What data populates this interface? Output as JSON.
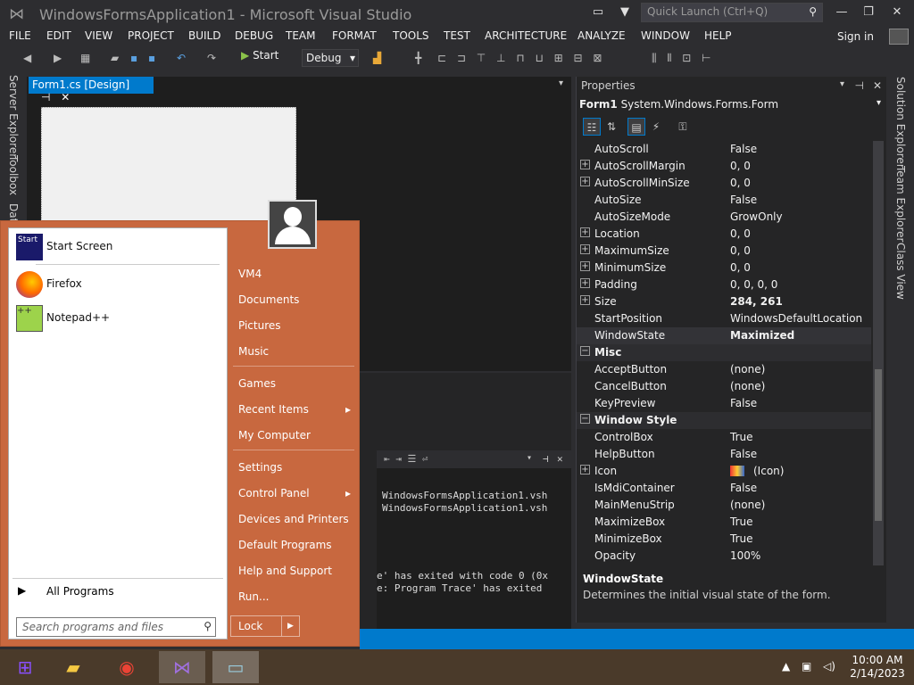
{
  "window": {
    "title": "WindowsFormsApplication1 - Microsoft Visual Studio",
    "quick_launch_placeholder": "Quick Launch (Ctrl+Q)"
  },
  "menu": [
    "FILE",
    "EDIT",
    "VIEW",
    "PROJECT",
    "BUILD",
    "DEBUG",
    "TEAM",
    "FORMAT",
    "TOOLS",
    "TEST",
    "ARCHITECTURE",
    "ANALYZE",
    "WINDOW",
    "HELP"
  ],
  "sign_in": "Sign in",
  "toolbar": {
    "start_label": "Start",
    "config": "Debug"
  },
  "doc_tab": "Form1.cs [Design]",
  "left_tabs": [
    "Server Explorer",
    "Toolbox",
    "Dat"
  ],
  "right_tabs": [
    "Solution Explorer",
    "Team Explorer",
    "Class View"
  ],
  "output": {
    "lines": [
      "WindowsFormsApplication1.vsh",
      "WindowsFormsApplication1.vsh",
      "e' has exited with code 0 (0x",
      "e: Program Trace' has exited"
    ]
  },
  "properties": {
    "header": "Properties",
    "object_name": "Form1",
    "object_type": "System.Windows.Forms.Form",
    "rows": [
      {
        "name": "AutoScroll",
        "value": "False"
      },
      {
        "name": "AutoScrollMargin",
        "value": "0, 0",
        "expand": true
      },
      {
        "name": "AutoScrollMinSize",
        "value": "0, 0",
        "expand": true
      },
      {
        "name": "AutoSize",
        "value": "False"
      },
      {
        "name": "AutoSizeMode",
        "value": "GrowOnly"
      },
      {
        "name": "Location",
        "value": "0, 0",
        "expand": true
      },
      {
        "name": "MaximumSize",
        "value": "0, 0",
        "expand": true
      },
      {
        "name": "MinimumSize",
        "value": "0, 0",
        "expand": true
      },
      {
        "name": "Padding",
        "value": "0, 0, 0, 0",
        "expand": true
      },
      {
        "name": "Size",
        "value": "284, 261",
        "expand": true,
        "bold": true
      },
      {
        "name": "StartPosition",
        "value": "WindowsDefaultLocation"
      },
      {
        "name": "WindowState",
        "value": "Maximized",
        "bold": true,
        "selected": true
      },
      {
        "name": "Misc",
        "category": true
      },
      {
        "name": "AcceptButton",
        "value": "(none)"
      },
      {
        "name": "CancelButton",
        "value": "(none)"
      },
      {
        "name": "KeyPreview",
        "value": "False"
      },
      {
        "name": "Window Style",
        "category": true
      },
      {
        "name": "ControlBox",
        "value": "True"
      },
      {
        "name": "HelpButton",
        "value": "False"
      },
      {
        "name": "Icon",
        "value": "(Icon)",
        "expand": true,
        "icon": true
      },
      {
        "name": "IsMdiContainer",
        "value": "False"
      },
      {
        "name": "MainMenuStrip",
        "value": "(none)"
      },
      {
        "name": "MaximizeBox",
        "value": "True"
      },
      {
        "name": "MinimizeBox",
        "value": "True"
      },
      {
        "name": "Opacity",
        "value": "100%"
      }
    ],
    "desc_title": "WindowState",
    "desc_text": "Determines the initial visual state of the form."
  },
  "start_menu": {
    "left_items": [
      {
        "label": "Start Screen",
        "icon": "start-screen-icon"
      },
      {
        "label": "Firefox",
        "icon": "firefox-icon"
      },
      {
        "label": "Notepad++",
        "icon": "notepadpp-icon"
      }
    ],
    "all_programs": "All Programs",
    "search_placeholder": "Search programs and files",
    "right_items": [
      {
        "label": "VM4"
      },
      {
        "label": "Documents"
      },
      {
        "label": "Pictures"
      },
      {
        "label": "Music"
      },
      {
        "label": "Games"
      },
      {
        "label": "Recent Items",
        "arrow": true
      },
      {
        "label": "My Computer"
      },
      {
        "label": "Settings"
      },
      {
        "label": "Control Panel",
        "arrow": true
      },
      {
        "label": "Devices and Printers"
      },
      {
        "label": "Default Programs"
      },
      {
        "label": "Help and Support"
      },
      {
        "label": "Run..."
      }
    ],
    "lock_label": "Lock"
  },
  "taskbar": {
    "time": "10:00 AM",
    "date": "2/14/2023",
    "apps": [
      "explorer-icon",
      "chrome-icon",
      "visual-studio-icon",
      "remote-desktop-icon"
    ]
  }
}
